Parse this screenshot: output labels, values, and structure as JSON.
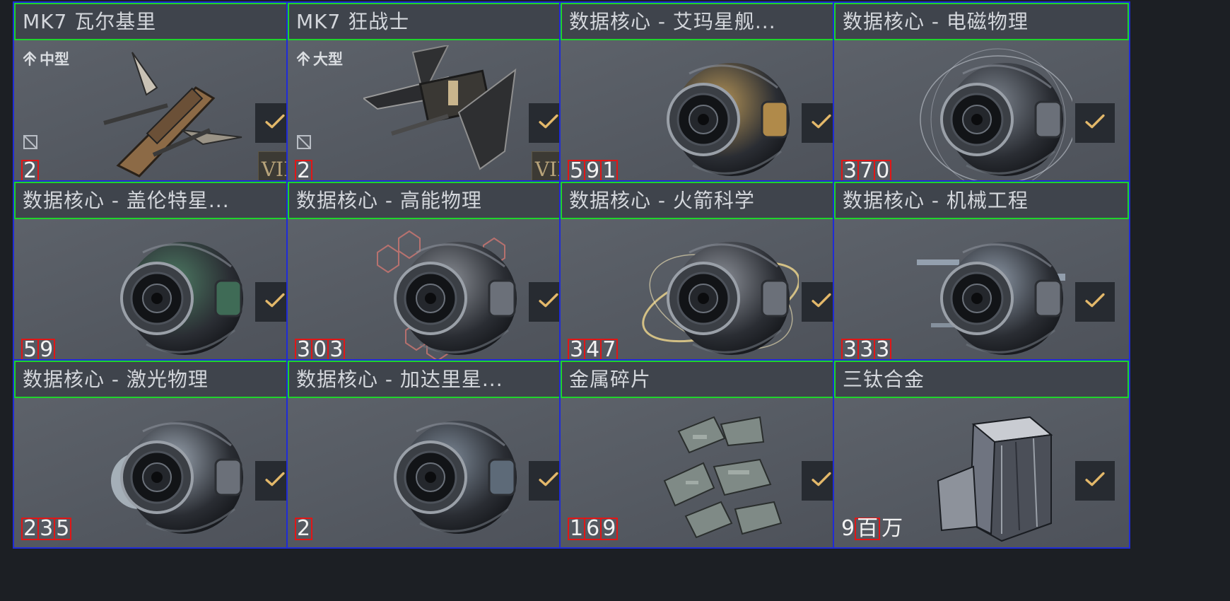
{
  "items": [
    {
      "title": "MK7 瓦尔基里",
      "size_label": "中型",
      "quantity": "2",
      "tier": "VII",
      "art": "ship-a",
      "has_slot": true
    },
    {
      "title": "MK7 狂战士",
      "size_label": "大型",
      "quantity": "2",
      "tier": "VII",
      "art": "ship-b",
      "has_slot": true
    },
    {
      "title": "数据核心 - 艾玛星舰...",
      "quantity": "591",
      "art": "core-gold"
    },
    {
      "title": "数据核心 - 电磁物理",
      "quantity": "370",
      "art": "core-electro"
    },
    {
      "title": "数据核心 - 盖伦特星...",
      "quantity": "59",
      "art": "core-green"
    },
    {
      "title": "数据核心 - 高能物理",
      "quantity": "303",
      "art": "core-hex"
    },
    {
      "title": "数据核心 - 火箭科学",
      "quantity": "347",
      "art": "core-orbit"
    },
    {
      "title": "数据核心 - 机械工程",
      "quantity": "333",
      "art": "core-blue"
    },
    {
      "title": "数据核心 - 激光物理",
      "quantity": "235",
      "art": "core-laser"
    },
    {
      "title": "数据核心 - 加达里星...",
      "quantity": "2",
      "art": "core-caldari"
    },
    {
      "title": "金属碎片",
      "quantity": "169",
      "art": "scrap"
    },
    {
      "title": "三钛合金",
      "quantity_prefix": "9",
      "quantity": "百",
      "quantity_suffix": "万",
      "art": "ingot"
    }
  ],
  "colors": {
    "card_border": "#1f2bd8",
    "title_border": "#1fd42c",
    "qty_border": "#e11616",
    "check_color": "#e3b86a"
  }
}
